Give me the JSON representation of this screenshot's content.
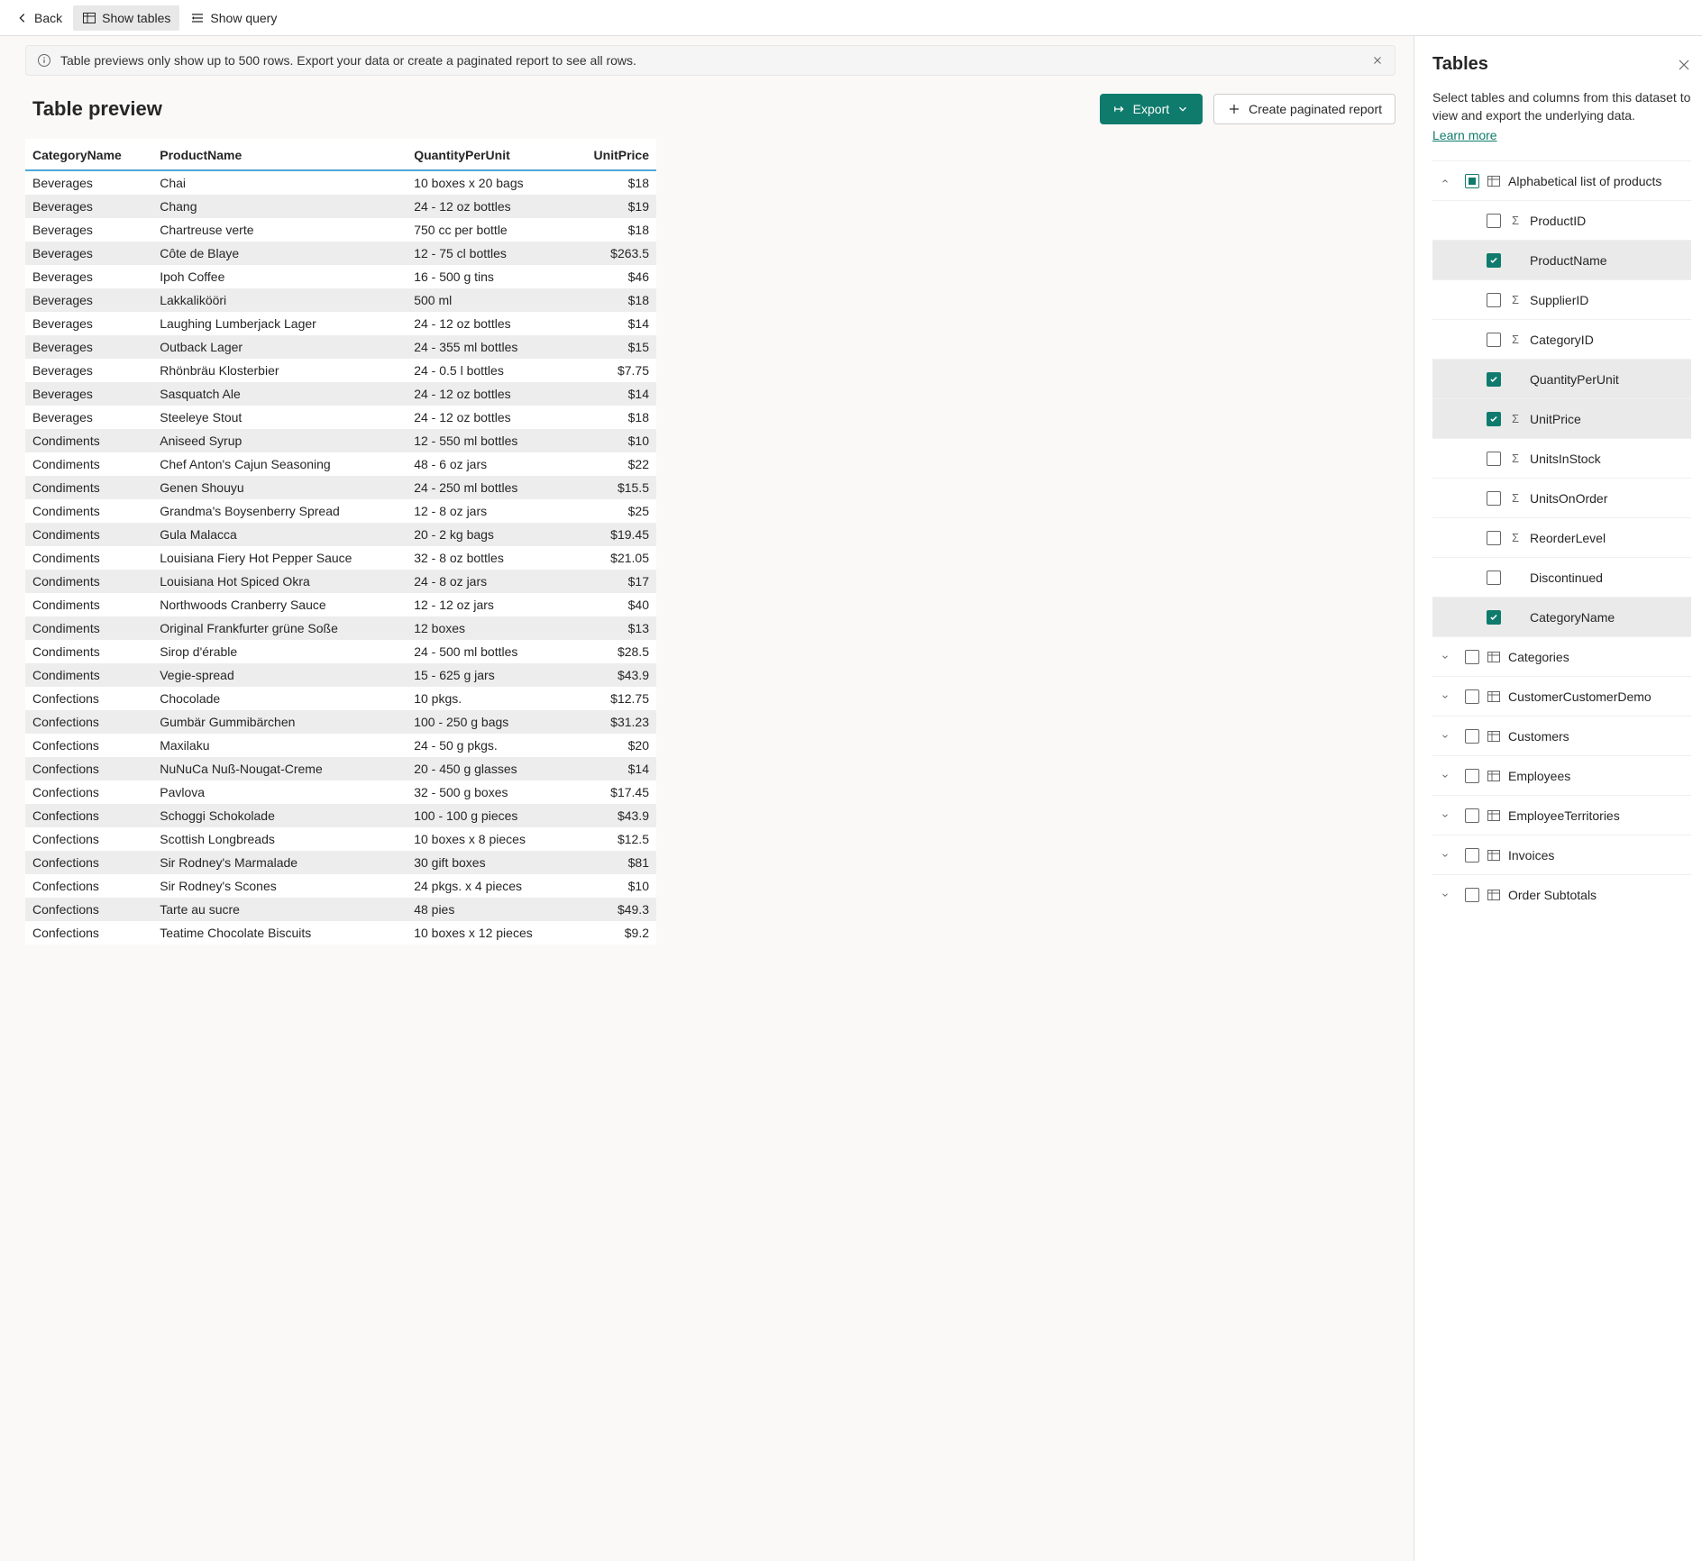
{
  "toolbar": {
    "back": "Back",
    "show_tables": "Show tables",
    "show_query": "Show query"
  },
  "banner": {
    "text": "Table previews only show up to 500 rows. Export your data or create a paginated report to see all rows."
  },
  "preview": {
    "title": "Table preview",
    "export": "Export",
    "create_report": "Create paginated report"
  },
  "columns": [
    "CategoryName",
    "ProductName",
    "QuantityPerUnit",
    "UnitPrice"
  ],
  "rows": [
    {
      "cat": "Beverages",
      "prod": "Chai",
      "qty": "10 boxes x 20 bags",
      "price": "$18"
    },
    {
      "cat": "Beverages",
      "prod": "Chang",
      "qty": "24 - 12 oz bottles",
      "price": "$19"
    },
    {
      "cat": "Beverages",
      "prod": "Chartreuse verte",
      "qty": "750 cc per bottle",
      "price": "$18"
    },
    {
      "cat": "Beverages",
      "prod": "Côte de Blaye",
      "qty": "12 - 75 cl bottles",
      "price": "$263.5"
    },
    {
      "cat": "Beverages",
      "prod": "Ipoh Coffee",
      "qty": "16 - 500 g tins",
      "price": "$46"
    },
    {
      "cat": "Beverages",
      "prod": "Lakkalikööri",
      "qty": "500 ml",
      "price": "$18"
    },
    {
      "cat": "Beverages",
      "prod": "Laughing Lumberjack Lager",
      "qty": "24 - 12 oz bottles",
      "price": "$14"
    },
    {
      "cat": "Beverages",
      "prod": "Outback Lager",
      "qty": "24 - 355 ml bottles",
      "price": "$15"
    },
    {
      "cat": "Beverages",
      "prod": "Rhönbräu Klosterbier",
      "qty": "24 - 0.5 l bottles",
      "price": "$7.75"
    },
    {
      "cat": "Beverages",
      "prod": "Sasquatch Ale",
      "qty": "24 - 12 oz bottles",
      "price": "$14"
    },
    {
      "cat": "Beverages",
      "prod": "Steeleye Stout",
      "qty": "24 - 12 oz bottles",
      "price": "$18"
    },
    {
      "cat": "Condiments",
      "prod": "Aniseed Syrup",
      "qty": "12 - 550 ml bottles",
      "price": "$10"
    },
    {
      "cat": "Condiments",
      "prod": "Chef Anton's Cajun Seasoning",
      "qty": "48 - 6 oz jars",
      "price": "$22"
    },
    {
      "cat": "Condiments",
      "prod": "Genen Shouyu",
      "qty": "24 - 250 ml bottles",
      "price": "$15.5"
    },
    {
      "cat": "Condiments",
      "prod": "Grandma's Boysenberry Spread",
      "qty": "12 - 8 oz jars",
      "price": "$25"
    },
    {
      "cat": "Condiments",
      "prod": "Gula Malacca",
      "qty": "20 - 2 kg bags",
      "price": "$19.45"
    },
    {
      "cat": "Condiments",
      "prod": "Louisiana Fiery Hot Pepper Sauce",
      "qty": "32 - 8 oz bottles",
      "price": "$21.05"
    },
    {
      "cat": "Condiments",
      "prod": "Louisiana Hot Spiced Okra",
      "qty": "24 - 8 oz jars",
      "price": "$17"
    },
    {
      "cat": "Condiments",
      "prod": "Northwoods Cranberry Sauce",
      "qty": "12 - 12 oz jars",
      "price": "$40"
    },
    {
      "cat": "Condiments",
      "prod": "Original Frankfurter grüne Soße",
      "qty": "12 boxes",
      "price": "$13"
    },
    {
      "cat": "Condiments",
      "prod": "Sirop d'érable",
      "qty": "24 - 500 ml bottles",
      "price": "$28.5"
    },
    {
      "cat": "Condiments",
      "prod": "Vegie-spread",
      "qty": "15 - 625 g jars",
      "price": "$43.9"
    },
    {
      "cat": "Confections",
      "prod": "Chocolade",
      "qty": "10 pkgs.",
      "price": "$12.75"
    },
    {
      "cat": "Confections",
      "prod": "Gumbär Gummibärchen",
      "qty": "100 - 250 g bags",
      "price": "$31.23"
    },
    {
      "cat": "Confections",
      "prod": "Maxilaku",
      "qty": "24 - 50 g pkgs.",
      "price": "$20"
    },
    {
      "cat": "Confections",
      "prod": "NuNuCa Nuß-Nougat-Creme",
      "qty": "20 - 450 g glasses",
      "price": "$14"
    },
    {
      "cat": "Confections",
      "prod": "Pavlova",
      "qty": "32 - 500 g boxes",
      "price": "$17.45"
    },
    {
      "cat": "Confections",
      "prod": "Schoggi Schokolade",
      "qty": "100 - 100 g pieces",
      "price": "$43.9"
    },
    {
      "cat": "Confections",
      "prod": "Scottish Longbreads",
      "qty": "10 boxes x 8 pieces",
      "price": "$12.5"
    },
    {
      "cat": "Confections",
      "prod": "Sir Rodney's Marmalade",
      "qty": "30 gift boxes",
      "price": "$81"
    },
    {
      "cat": "Confections",
      "prod": "Sir Rodney's Scones",
      "qty": "24 pkgs. x 4 pieces",
      "price": "$10"
    },
    {
      "cat": "Confections",
      "prod": "Tarte au sucre",
      "qty": "48 pies",
      "price": "$49.3"
    },
    {
      "cat": "Confections",
      "prod": "Teatime Chocolate Biscuits",
      "qty": "10 boxes x 12 pieces",
      "price": "$9.2"
    }
  ],
  "tables_panel": {
    "title": "Tables",
    "description": "Select tables and columns from this dataset to view and export the underlying data.",
    "learn_more": "Learn more",
    "expanded_table": "Alphabetical list of products",
    "fields": [
      {
        "name": "ProductID",
        "checked": false,
        "sigma": true
      },
      {
        "name": "ProductName",
        "checked": true,
        "sigma": false
      },
      {
        "name": "SupplierID",
        "checked": false,
        "sigma": true
      },
      {
        "name": "CategoryID",
        "checked": false,
        "sigma": true
      },
      {
        "name": "QuantityPerUnit",
        "checked": true,
        "sigma": false
      },
      {
        "name": "UnitPrice",
        "checked": true,
        "sigma": true
      },
      {
        "name": "UnitsInStock",
        "checked": false,
        "sigma": true
      },
      {
        "name": "UnitsOnOrder",
        "checked": false,
        "sigma": true
      },
      {
        "name": "ReorderLevel",
        "checked": false,
        "sigma": true
      },
      {
        "name": "Discontinued",
        "checked": false,
        "sigma": false
      },
      {
        "name": "CategoryName",
        "checked": true,
        "sigma": false
      }
    ],
    "other_tables": [
      "Categories",
      "CustomerCustomerDemo",
      "Customers",
      "Employees",
      "EmployeeTerritories",
      "Invoices",
      "Order Subtotals"
    ]
  }
}
